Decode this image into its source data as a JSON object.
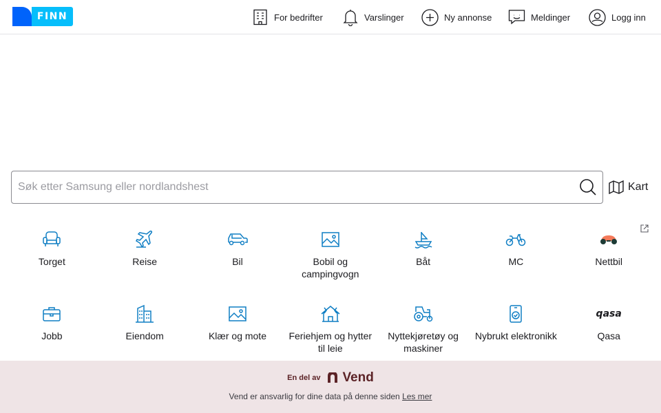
{
  "header": {
    "logo_text": "FINN",
    "nav": [
      {
        "label": "For bedrifter",
        "icon": "building-icon"
      },
      {
        "label": "Varslinger",
        "icon": "bell-icon"
      },
      {
        "label": "Ny annonse",
        "icon": "plus-circle-icon"
      },
      {
        "label": "Meldinger",
        "icon": "chat-icon"
      },
      {
        "label": "Logg inn",
        "icon": "user-circle-icon"
      }
    ]
  },
  "search": {
    "placeholder": "Søk etter Samsung eller nordlandshest",
    "value": "",
    "map_label": "Kart"
  },
  "categories": [
    {
      "label": "Torget",
      "icon": "armchair-icon"
    },
    {
      "label": "Reise",
      "icon": "airplane-icon"
    },
    {
      "label": "Bil",
      "icon": "car-icon"
    },
    {
      "label": "Bobil og campingvogn",
      "icon": "picture-icon"
    },
    {
      "label": "Båt",
      "icon": "boat-icon"
    },
    {
      "label": "MC",
      "icon": "motorcycle-icon"
    },
    {
      "label": "Nettbil",
      "icon": "nettbil-logo-icon",
      "external": true
    },
    {
      "label": "Jobb",
      "icon": "briefcase-icon"
    },
    {
      "label": "Eiendom",
      "icon": "buildings-icon"
    },
    {
      "label": "Klær og mote",
      "icon": "picture-icon"
    },
    {
      "label": "Feriehjem og hytter til leie",
      "icon": "cabin-icon"
    },
    {
      "label": "Nyttekjøretøy og maskiner",
      "icon": "tractor-icon"
    },
    {
      "label": "Nybrukt elektronikk",
      "icon": "phone-check-icon"
    },
    {
      "label": "Qasa",
      "icon": "qasa-logo-icon",
      "logo_text": "qasa"
    }
  ],
  "footer": {
    "part_of": "En del av",
    "brand": "Vend",
    "text": "Vend er ansvarlig for dine data på denne siden",
    "link": "Les mer"
  },
  "colors": {
    "logo_blue": "#0063fb",
    "logo_light_blue": "#06befb",
    "icon_blue": "#0f7ec4",
    "footer_bg": "#efe4e6",
    "vend_brand": "#5c2327"
  }
}
